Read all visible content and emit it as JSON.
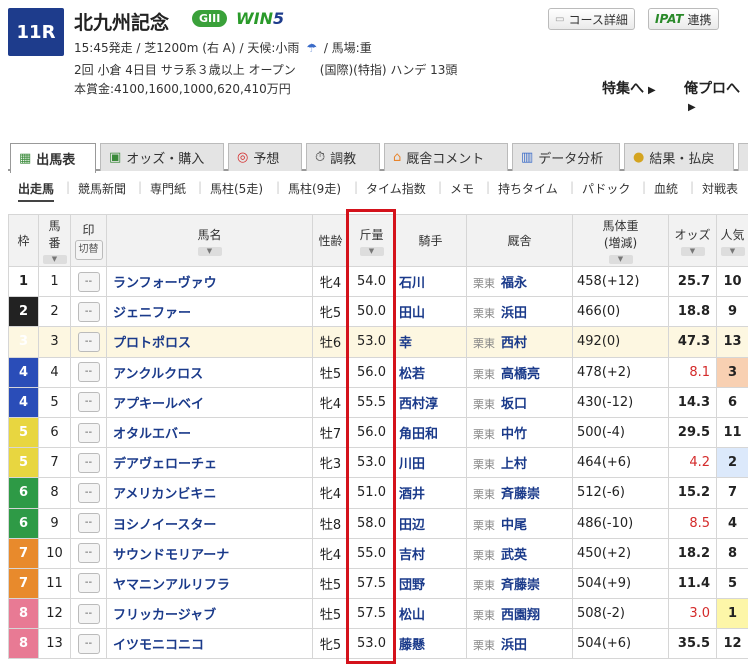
{
  "race": {
    "number": "11R",
    "name": "北九州記念",
    "grade": "GIII",
    "win5_a": "WIN",
    "win5_b": "5",
    "info1": "15:45発走 / 芝1200m (右 A) / 天候:小雨",
    "weather_icon": "umbrella-icon",
    "info1_b": "/ 馬場:重",
    "info2": "2回 小倉 4日目 サラ系３歳以上 オープン　　(国際)(特指) ハンデ 13頭",
    "info3": "本賞金:4100,1600,1000,620,410万円",
    "course_btn": "コース詳細",
    "ipat_btn_brand": "IPAT",
    "ipat_btn_label": "連携",
    "link_special": "特集へ",
    "link_pro": "俺プロへ"
  },
  "tabs": [
    {
      "label": "出馬表",
      "icon": "table-icon",
      "active": true
    },
    {
      "label": "オッズ・購入",
      "icon": "ticket-icon"
    },
    {
      "label": "予想",
      "icon": "target-icon"
    },
    {
      "label": "調教",
      "icon": "stopwatch-icon"
    },
    {
      "label": "厩舎コメント",
      "icon": "stable-icon"
    },
    {
      "label": "データ分析",
      "icon": "bar-chart-icon"
    },
    {
      "label": "結果・払戻",
      "icon": "coins-icon"
    }
  ],
  "subnav": [
    "出走馬",
    "競馬新聞",
    "専門紙",
    "馬柱(5走)",
    "馬柱(9走)",
    "タイム指数",
    "メモ",
    "持ちタイム",
    "パドック",
    "血統",
    "対戦表"
  ],
  "columns": {
    "waku": "枠",
    "umaban_1": "馬",
    "umaban_2": "番",
    "mark": "印",
    "mark_btn": "切替",
    "name": "馬名",
    "sexage": "性齢",
    "kinryo": "斤量",
    "jockey": "騎手",
    "trainer": "厩舎",
    "weight_1": "馬体重",
    "weight_2": "(増減)",
    "odds": "オッズ",
    "pop": "人気"
  },
  "mark_placeholder": "--",
  "horses": [
    {
      "waku": "1",
      "num": "1",
      "name": "ランフォーヴァウ",
      "sexage": "牝4",
      "kinryo": "54.0",
      "jockey": "石川",
      "loc": "栗東",
      "trainer": "福永",
      "weight": "458(+12)",
      "odds": "25.7",
      "pop": "10"
    },
    {
      "waku": "2",
      "num": "2",
      "name": "ジェニファー",
      "sexage": "牝5",
      "kinryo": "50.0",
      "jockey": "田山",
      "loc": "栗東",
      "trainer": "浜田",
      "weight": "466(0)",
      "odds": "18.8",
      "pop": "9"
    },
    {
      "waku": "3",
      "num": "3",
      "name": "プロトポロス",
      "sexage": "牡6",
      "kinryo": "53.0",
      "jockey": "幸",
      "loc": "栗東",
      "trainer": "西村",
      "weight": "492(0)",
      "odds": "47.3",
      "pop": "13"
    },
    {
      "waku": "4",
      "num": "4",
      "name": "アンクルクロス",
      "sexage": "牡5",
      "kinryo": "56.0",
      "jockey": "松若",
      "loc": "栗東",
      "trainer": "高橋亮",
      "weight": "478(+2)",
      "odds": "8.1",
      "pop": "3"
    },
    {
      "waku": "4",
      "num": "5",
      "name": "アプキールベイ",
      "sexage": "牝4",
      "kinryo": "55.5",
      "jockey": "西村淳",
      "loc": "栗東",
      "trainer": "坂口",
      "weight": "430(-12)",
      "odds": "14.3",
      "pop": "6"
    },
    {
      "waku": "5",
      "num": "6",
      "name": "オタルエバー",
      "sexage": "牡7",
      "kinryo": "56.0",
      "jockey": "角田和",
      "loc": "栗東",
      "trainer": "中竹",
      "weight": "500(-4)",
      "odds": "29.5",
      "pop": "11"
    },
    {
      "waku": "5",
      "num": "7",
      "name": "デアヴェローチェ",
      "sexage": "牝3",
      "kinryo": "53.0",
      "jockey": "川田",
      "loc": "栗東",
      "trainer": "上村",
      "weight": "464(+6)",
      "odds": "4.2",
      "pop": "2"
    },
    {
      "waku": "6",
      "num": "8",
      "name": "アメリカンビキニ",
      "sexage": "牝4",
      "kinryo": "51.0",
      "jockey": "酒井",
      "loc": "栗東",
      "trainer": "斉藤崇",
      "weight": "512(-6)",
      "odds": "15.2",
      "pop": "7"
    },
    {
      "waku": "6",
      "num": "9",
      "name": "ヨシノイースター",
      "sexage": "牡8",
      "kinryo": "58.0",
      "jockey": "田辺",
      "loc": "栗東",
      "trainer": "中尾",
      "weight": "486(-10)",
      "odds": "8.5",
      "pop": "4"
    },
    {
      "waku": "7",
      "num": "10",
      "name": "サウンドモリアーナ",
      "sexage": "牝4",
      "kinryo": "55.0",
      "jockey": "吉村",
      "loc": "栗東",
      "trainer": "武英",
      "weight": "450(+2)",
      "odds": "18.2",
      "pop": "8"
    },
    {
      "waku": "7",
      "num": "11",
      "name": "ヤマニンアルリフラ",
      "sexage": "牡5",
      "kinryo": "57.5",
      "jockey": "団野",
      "loc": "栗東",
      "trainer": "斉藤崇",
      "weight": "504(+9)",
      "odds": "11.4",
      "pop": "5"
    },
    {
      "waku": "8",
      "num": "12",
      "name": "フリッカージャブ",
      "sexage": "牡5",
      "kinryo": "57.5",
      "jockey": "松山",
      "loc": "栗東",
      "trainer": "西園翔",
      "weight": "508(-2)",
      "odds": "3.0",
      "pop": "1"
    },
    {
      "waku": "8",
      "num": "13",
      "name": "イツモニコニコ",
      "sexage": "牝5",
      "kinryo": "53.0",
      "jockey": "藤懸",
      "loc": "栗東",
      "trainer": "浜田",
      "weight": "504(+6)",
      "odds": "35.5",
      "pop": "12"
    }
  ],
  "colors": {
    "highlight_box": "#d4121b",
    "race_badge": "#1e3c8c",
    "grade_badge": "#3aa13a",
    "link_text": "#1a3a8a",
    "hot_odds": "#d42b2b"
  }
}
